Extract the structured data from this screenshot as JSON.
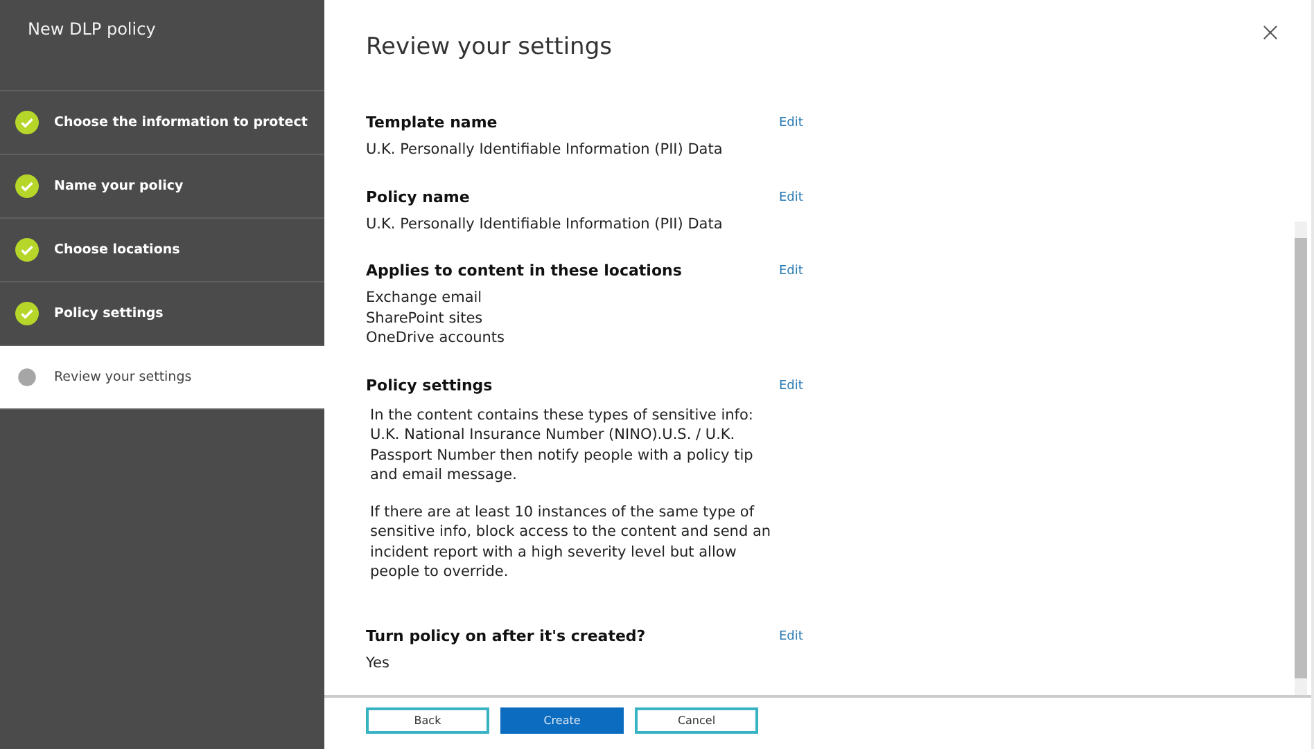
{
  "wizard": {
    "title": "New DLP policy",
    "steps": [
      {
        "label": "Choose the information to protect",
        "completed": true,
        "selected": false
      },
      {
        "label": "Name your policy",
        "completed": true,
        "selected": false
      },
      {
        "label": "Choose locations",
        "completed": true,
        "selected": false
      },
      {
        "label": "Policy settings",
        "completed": true,
        "selected": false
      },
      {
        "label": "Review your settings",
        "completed": false,
        "selected": true
      }
    ]
  },
  "panel": {
    "title": "Review your settings",
    "sections": [
      {
        "heading": "Template name",
        "lines": [
          "U.K. Personally Identifiable Information (PII) Data"
        ],
        "edit": "Edit"
      },
      {
        "heading": "Policy name",
        "lines": [
          "U.K. Personally Identifiable Information (PII) Data"
        ],
        "edit": "Edit"
      },
      {
        "heading": "Applies to content in these locations",
        "lines": [
          "Exchange email",
          "SharePoint sites",
          "OneDrive accounts"
        ],
        "edit": "Edit"
      },
      {
        "heading": "Policy settings",
        "paragraphs": [
          "In the content contains these types of sensitive info: U.K. National Insurance Number (NINO).U.S. / U.K. Passport Number then notify people with a policy tip and email message.",
          "If there are at least 10 instances of the same type of sensitive info, block access to the content and send an incident report with a high severity level but allow people to override."
        ],
        "edit": "Edit"
      },
      {
        "heading": "Turn policy on after it's created?",
        "lines": [
          "Yes"
        ],
        "edit": "Edit"
      }
    ],
    "buttons": [
      {
        "label": "Back",
        "primary": false
      },
      {
        "label": "Create",
        "primary": true
      },
      {
        "label": "Cancel",
        "primary": false
      }
    ]
  }
}
